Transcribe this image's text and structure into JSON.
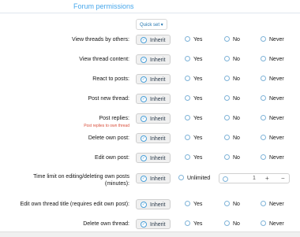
{
  "section": {
    "title": "Forum permissions"
  },
  "quick_set": {
    "label": "Quick set ▾"
  },
  "options": {
    "inherit": "Inherit",
    "yes": "Yes",
    "no": "No",
    "never": "Never",
    "unlimited": "Unlimited"
  },
  "permissions": [
    {
      "label": "View threads by others:"
    },
    {
      "label": "View thread content:"
    },
    {
      "label": "React to posts:"
    },
    {
      "label": "Post new thread:"
    },
    {
      "label": "Post replies:",
      "hint": "Post replies to own thread"
    },
    {
      "label": "Delete own post:"
    },
    {
      "label": "Edit own post:"
    },
    {
      "label": "Time limit on editing/deleting own posts (minutes):",
      "stepper_value": "1"
    },
    {
      "label": "Edit own thread title (requires edit own post):"
    },
    {
      "label": "Delete own thread:"
    }
  ],
  "stepper": {
    "plus": "+",
    "minus": "−"
  }
}
